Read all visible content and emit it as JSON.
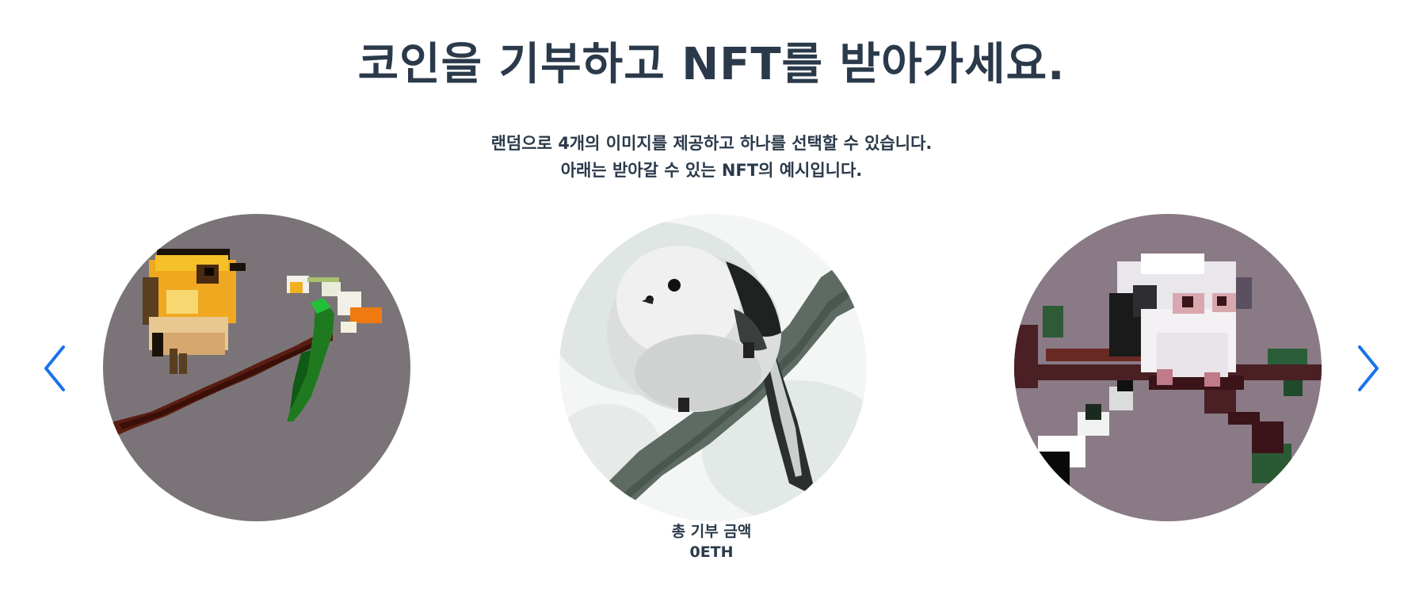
{
  "header": {
    "title": "코인을 기부하고 NFT를 받아가세요.",
    "line1": "랜덤으로 4개의 이미지를 제공하고 하나를 선택할 수 있습니다.",
    "line2": "아래는 받아갈 수 있는 NFT의 예시입니다."
  },
  "carousel": {
    "prev_icon": "chevron-left-icon",
    "next_icon": "chevron-right-icon",
    "accent_color": "#1a73e8",
    "slides": [
      {
        "style": "pixel-art",
        "subject": "yellow bird on branch with flowers"
      },
      {
        "style": "painting",
        "subject": "white long-tailed tit on branch"
      },
      {
        "style": "pixel-art",
        "subject": "white bird on branch"
      }
    ]
  },
  "donation": {
    "label": "총 기부 금액",
    "value": "0ETH"
  }
}
